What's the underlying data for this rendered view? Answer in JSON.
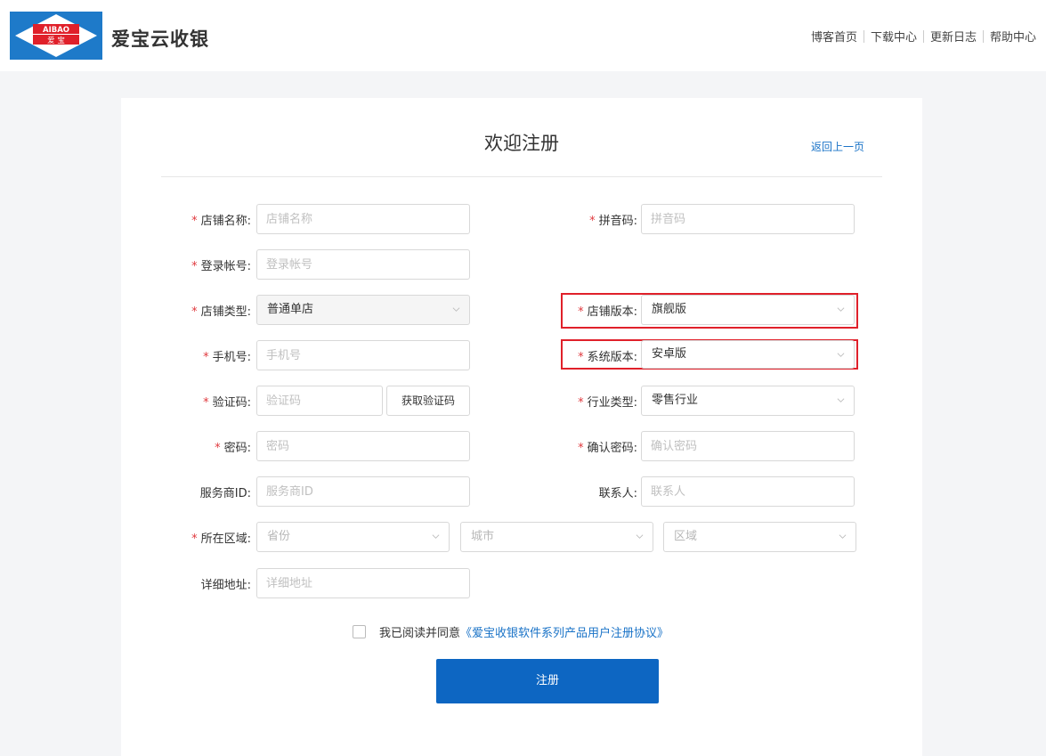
{
  "header": {
    "logo_text_top": "AIBAO",
    "logo_text_bottom": "爱 宝",
    "brand": "爱宝云收银",
    "nav": [
      "博客首页",
      "下载中心",
      "更新日志",
      "帮助中心"
    ]
  },
  "form": {
    "title": "欢迎注册",
    "back_link": "返回上一页",
    "fields": {
      "store_name": {
        "label": "店铺名称:",
        "placeholder": "店铺名称",
        "required": true
      },
      "pinyin": {
        "label": "拼音码:",
        "placeholder": "拼音码",
        "required": true
      },
      "login_account": {
        "label": "登录帐号:",
        "placeholder": "登录帐号",
        "required": true
      },
      "store_type": {
        "label": "店铺类型:",
        "value": "普通单店",
        "required": true,
        "disabled": true
      },
      "store_edition": {
        "label": "店铺版本:",
        "value": "旗舰版",
        "required": true,
        "highlighted": true
      },
      "phone": {
        "label": "手机号:",
        "placeholder": "手机号",
        "required": true
      },
      "system_edition": {
        "label": "系统版本:",
        "value": "安卓版",
        "required": true,
        "highlighted": true
      },
      "verify_code": {
        "label": "验证码:",
        "placeholder": "验证码",
        "required": true,
        "button": "获取验证码"
      },
      "industry": {
        "label": "行业类型:",
        "value": "零售行业",
        "required": true
      },
      "password": {
        "label": "密码:",
        "placeholder": "密码",
        "required": true
      },
      "confirm_password": {
        "label": "确认密码:",
        "placeholder": "确认密码",
        "required": true
      },
      "provider_id": {
        "label": "服务商ID:",
        "placeholder": "服务商ID",
        "required": false
      },
      "contact": {
        "label": "联系人:",
        "placeholder": "联系人",
        "required": false
      },
      "region": {
        "label": "所在区域:",
        "required": true,
        "province": "省份",
        "city": "城市",
        "district": "区域"
      },
      "address": {
        "label": "详细地址:",
        "placeholder": "详细地址",
        "required": false
      }
    },
    "agreement": {
      "prefix": "我已阅读并同意",
      "link": "《爱宝收银软件系列产品用户注册协议》",
      "checked": false
    },
    "submit_label": "注册"
  },
  "colors": {
    "primary": "#0d66c2",
    "required_star": "#e0393e",
    "highlight_border": "#e0202a",
    "link": "#1a73c7"
  }
}
